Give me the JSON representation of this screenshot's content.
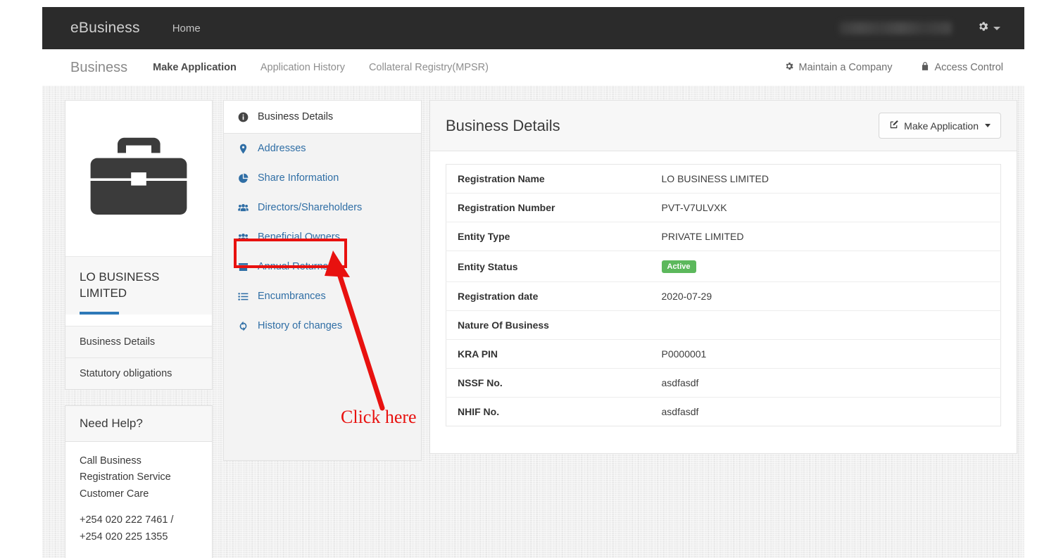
{
  "topbar": {
    "brand": "eBusiness",
    "home_label": "Home",
    "user_label": "",
    "gear_icon": "gear-icon",
    "caret_icon": "caret-down-icon"
  },
  "subnav": {
    "brand": "Business",
    "links": [
      {
        "label": "Make Application",
        "active": true
      },
      {
        "label": "Application History",
        "active": false
      },
      {
        "label": "Collateral Registry(MPSR)",
        "active": false
      }
    ],
    "right": [
      {
        "label": "Maintain a Company",
        "icon": "gear-icon"
      },
      {
        "label": "Access Control",
        "icon": "lock-icon"
      }
    ]
  },
  "sidebar": {
    "logo_icon": "briefcase-icon",
    "business_name": "LO BUSINESS LIMITED",
    "accent_color": "#2e79b8",
    "items": [
      {
        "label": "Business Details"
      },
      {
        "label": "Statutory obligations"
      }
    ],
    "help": {
      "title": "Need Help?",
      "line1": "Call Business Registration Service Customer Care",
      "line2": "+254 020 222 7461 /",
      "line3": "+254 020 225 1355"
    }
  },
  "midnav": {
    "active": {
      "label": "Business Details",
      "icon": "info-circle-icon"
    },
    "items": [
      {
        "label": "Addresses",
        "icon": "map-marker-icon"
      },
      {
        "label": "Share Information",
        "icon": "pie-chart-icon"
      },
      {
        "label": "Directors/Shareholders",
        "icon": "users-icon"
      },
      {
        "label": "Beneficial Owners",
        "icon": "users-icon"
      },
      {
        "label": "Annual Returns",
        "icon": "archive-icon"
      },
      {
        "label": "Encumbrances",
        "icon": "list-icon"
      },
      {
        "label": "History of changes",
        "icon": "refresh-icon"
      }
    ],
    "link_color": "#2f6ea5"
  },
  "main": {
    "title": "Business Details",
    "make_application_label": "Make Application",
    "make_application_icon": "pencil-square-icon",
    "rows": [
      {
        "label": "Registration Name",
        "value": "LO BUSINESS LIMITED",
        "badge": false
      },
      {
        "label": "Registration Number",
        "value": "PVT-V7ULVXK",
        "badge": false
      },
      {
        "label": "Entity Type",
        "value": "PRIVATE LIMITED",
        "badge": false
      },
      {
        "label": "Entity Status",
        "value": "Active",
        "badge": true
      },
      {
        "label": "Registration date",
        "value": "2020-07-29",
        "badge": false
      },
      {
        "label": "Nature Of Business",
        "value": "",
        "badge": false
      },
      {
        "label": "KRA PIN",
        "value": "P0000001",
        "badge": false
      },
      {
        "label": "NSSF No.",
        "value": "asdfasdf",
        "badge": false
      },
      {
        "label": "NHIF No.",
        "value": "asdfasdf",
        "badge": false
      }
    ],
    "badge_color": "#5cb85c"
  },
  "annotation": {
    "text": "Click here",
    "color": "#e8110f",
    "target": "Beneficial Owners"
  }
}
